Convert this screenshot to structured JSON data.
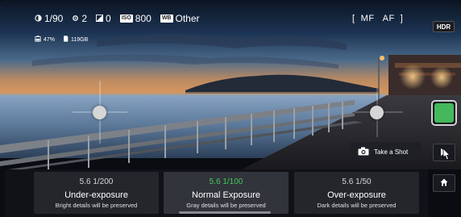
{
  "hud": {
    "shutter": "1/90",
    "ev": "2",
    "flash": "0",
    "iso_badge": "ISO",
    "iso": "800",
    "wb_badge": "WB",
    "wb": "Other",
    "battery": "47%",
    "storage": "119GB",
    "focus_modes": "[  MF   AF  ]"
  },
  "buttons": {
    "hdr": "HDR",
    "take_shot": "Take a Shot"
  },
  "exposure_options": [
    {
      "ev": "5.6 1/200",
      "title": "Under-exposure",
      "subtitle": "Bright details will be preserved"
    },
    {
      "ev": "5.6 1/100",
      "title": "Normal Exposure",
      "subtitle": "Gray details will be preserved"
    },
    {
      "ev": "5.6 1/50",
      "title": "Over-exposure",
      "subtitle": "Dark details will be preserved"
    }
  ],
  "colors": {
    "shutter_green": "#44b85b",
    "selected_value_green": "#46c95a"
  }
}
